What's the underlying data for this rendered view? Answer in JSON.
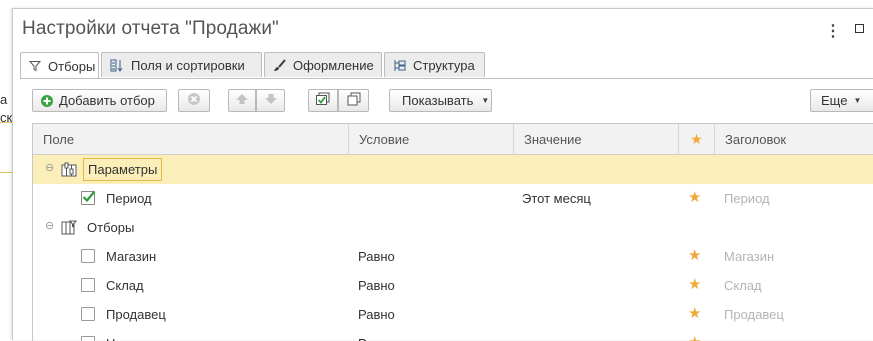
{
  "background": {
    "text_line1": "а",
    "text_line2": "ск"
  },
  "dialog": {
    "title": "Настройки отчета \"Продажи\"",
    "more_icon": "⋮",
    "maximize_icon": "maximize-icon"
  },
  "tabs": [
    {
      "label": "Отборы",
      "icon": "filter-icon",
      "active": true
    },
    {
      "label": "Поля и сортировки",
      "icon": "fields-icon",
      "active": false
    },
    {
      "label": "Оформление",
      "icon": "brush-icon",
      "active": false
    },
    {
      "label": "Структура",
      "icon": "structure-icon",
      "active": false
    }
  ],
  "toolbar": {
    "add_filter": "Добавить отбор",
    "show": "Показывать",
    "more": "Еще"
  },
  "grid": {
    "columns": {
      "field": "Поле",
      "condition": "Условие",
      "value": "Значение",
      "star": "★",
      "header": "Заголовок"
    },
    "rows": [
      {
        "kind": "group",
        "field": "Параметры",
        "condition": "",
        "value": "",
        "header": "",
        "checked": null
      },
      {
        "kind": "item",
        "field": "Период",
        "condition": "",
        "value": "Этот месяц",
        "header": "Период",
        "checked": true
      },
      {
        "kind": "group",
        "field": "Отборы",
        "condition": "",
        "value": "",
        "header": "",
        "checked": null
      },
      {
        "kind": "item",
        "field": "Магазин",
        "condition": "Равно",
        "value": "",
        "header": "Магазин",
        "checked": false
      },
      {
        "kind": "item",
        "field": "Склад",
        "condition": "Равно",
        "value": "",
        "header": "Склад",
        "checked": false
      },
      {
        "kind": "item",
        "field": "Продавец",
        "condition": "Равно",
        "value": "",
        "header": "Продавец",
        "checked": false
      },
      {
        "kind": "item",
        "field": "Н",
        "condition": "Р",
        "value": "",
        "header": "",
        "checked": false
      }
    ]
  },
  "colors": {
    "accent_selected_row": "#fbeeb8",
    "star": "#f2a93b",
    "check": "#2f9a3a",
    "add_icon": "#3aa33f"
  }
}
